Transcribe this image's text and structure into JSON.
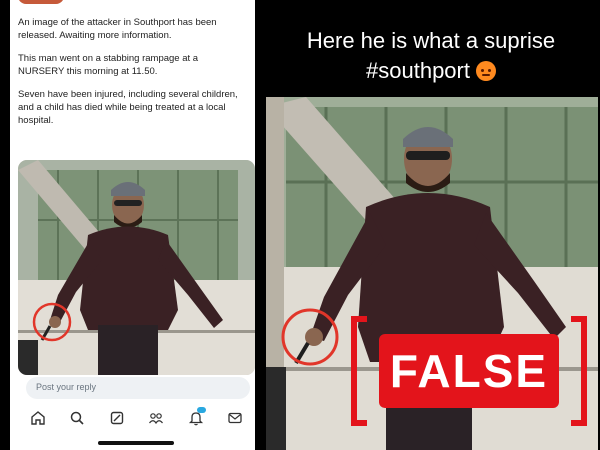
{
  "post": {
    "paragraphs": [
      "An image of the attacker in Southport has been released. Awaiting more information.",
      "This man went on a stabbing rampage at a NURSERY this morning at 11.50.",
      "Seven have been injured, including several children, and a child has died while being treated at a local hospital."
    ]
  },
  "reply": {
    "placeholder": "Post your reply"
  },
  "tabbar": {
    "icons": [
      "home-icon",
      "search-icon",
      "grok-icon",
      "communities-icon",
      "notifications-icon",
      "messages-icon"
    ]
  },
  "meme": {
    "caption_line1": "Here he is what a suprise",
    "caption_line2": "#southport",
    "emoji": "angry-face-emoji"
  },
  "stamp": {
    "label": "FALSE",
    "color": "#e3141b"
  }
}
